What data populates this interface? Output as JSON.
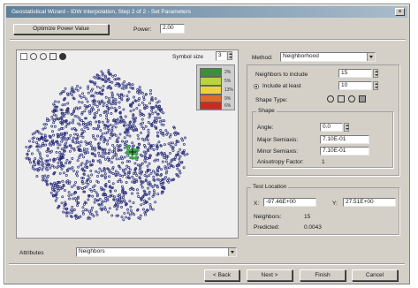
{
  "window": {
    "title": "Geostatistical Wizard - IDW Interpolation, Step 2 of 2 - Set Parameters"
  },
  "toolbar": {
    "optimize_label": "Optimize Power Value",
    "power_label": "Power:",
    "power_value": "2.00"
  },
  "preview": {
    "symbol_size_label": "Symbol size",
    "symbol_size_value": "3",
    "legend": [
      {
        "color": "#3d8f3d",
        "label": "2%"
      },
      {
        "color": "#b8d63a",
        "label": "5%"
      },
      {
        "color": "#e8d43a",
        "label": "13%"
      },
      {
        "color": "#e06a2a",
        "label": "9%"
      },
      {
        "color": "#cc2a1e",
        "label": "6%"
      }
    ],
    "points_color": "#2b2f7a",
    "highlight_color": "#3fa34a"
  },
  "method": {
    "label": "Method:",
    "value": "Neighborhood",
    "neighbors_label": "Neighbors to include",
    "neighbors_value": "15",
    "include_label": "Include at least",
    "include_value": "10",
    "shape_type_label": "Shape Type:"
  },
  "shape": {
    "title": "Shape",
    "angle_label": "Angle:",
    "angle_value": "0.0",
    "major_label": "Major Semiaxis:",
    "major_value": "7.10E-01",
    "minor_label": "Minor Semiaxis:",
    "minor_value": "7.10E-01",
    "anisotropy_label": "Anisotropy Factor:",
    "anisotropy_value": "1"
  },
  "test_location": {
    "title": "Test Location",
    "x_label": "X:",
    "x_value": "-97.46E+00",
    "y_label": "Y:",
    "y_value": "27.51E+00",
    "neighbors_label": "Neighbors:",
    "neighbors_value": "15",
    "predicted_label": "Predicted:",
    "predicted_value": "0.0043"
  },
  "footer": {
    "show_label": "Attributes",
    "show_value": "Neighbors"
  },
  "buttons": {
    "cancel": "< Back",
    "next": "Next >",
    "finish": "Finish",
    "help": "Cancel"
  }
}
